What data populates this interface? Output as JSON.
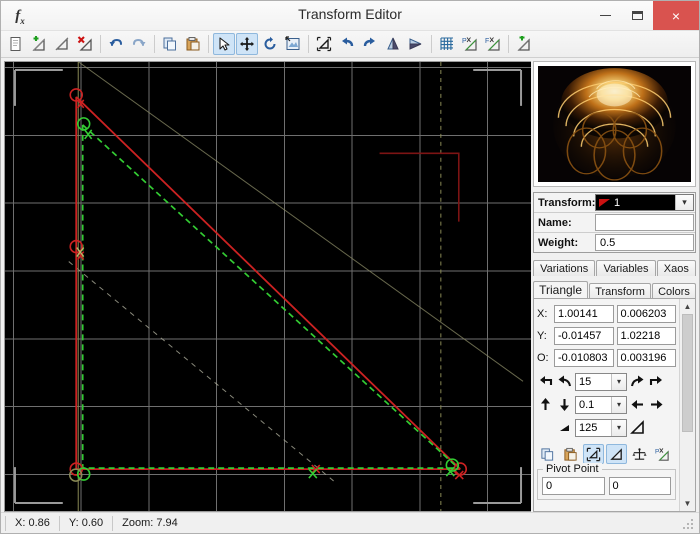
{
  "window": {
    "title": "Transform Editor",
    "app_icon": "fx-icon",
    "minimize_label": "Minimize",
    "maximize_label": "Maximize",
    "close_label": "×"
  },
  "toolbar": {
    "groups": [
      {
        "items": [
          {
            "name": "new-transform-icon",
            "label": "New Transform"
          },
          {
            "name": "add-transform-icon",
            "label": "Add Transform"
          },
          {
            "name": "duplicate-transform-icon",
            "label": "Duplicate Transform"
          },
          {
            "name": "delete-transform-icon",
            "label": "Delete Transform"
          }
        ]
      },
      {
        "items": [
          {
            "name": "undo-icon",
            "label": "Undo"
          },
          {
            "name": "redo-icon",
            "label": "Redo"
          }
        ]
      },
      {
        "items": [
          {
            "name": "copy-icon",
            "label": "Copy"
          },
          {
            "name": "paste-icon",
            "label": "Paste"
          }
        ]
      },
      {
        "items": [
          {
            "name": "select-tool-icon",
            "label": "Select",
            "active": true
          },
          {
            "name": "move-tool-icon",
            "label": "Move",
            "active": true
          },
          {
            "name": "rotate-tool-icon",
            "label": "Rotate"
          },
          {
            "name": "scale-tool-icon",
            "label": "Scale"
          }
        ]
      },
      {
        "items": [
          {
            "name": "reset-triangle-icon",
            "label": "Reset Triangle"
          },
          {
            "name": "rotate-left-icon",
            "label": "Rotate Left"
          },
          {
            "name": "rotate-right-icon",
            "label": "Rotate Right"
          },
          {
            "name": "flip-horizontal-icon",
            "label": "Flip Horizontal"
          },
          {
            "name": "flip-vertical-icon",
            "label": "Flip Vertical"
          }
        ]
      },
      {
        "items": [
          {
            "name": "toggle-grid-icon",
            "label": "Toggle Grid"
          },
          {
            "name": "post-transform-icon",
            "label": "Post Transform"
          },
          {
            "name": "final-transform-icon",
            "label": "Final Transform"
          }
        ]
      },
      {
        "items": [
          {
            "name": "add-final-transform-icon",
            "label": "Add Final Transform"
          }
        ]
      }
    ]
  },
  "preview": {
    "name": "flame-preview",
    "alt": "fractal flame preview"
  },
  "transform_form": {
    "transform_label": "Transform:",
    "transform_value": "1",
    "transform_swatch_color": "#cc1111",
    "name_label": "Name:",
    "name_value": "",
    "name_placeholder": "",
    "weight_label": "Weight:",
    "weight_value": "0.5"
  },
  "tabs_top": [
    {
      "label": "Variations",
      "active": false
    },
    {
      "label": "Variables",
      "active": false
    },
    {
      "label": "Xaos",
      "active": false
    }
  ],
  "tabs_bottom": [
    {
      "label": "Triangle",
      "active": true
    },
    {
      "label": "Transform",
      "active": false
    },
    {
      "label": "Colors",
      "active": false
    }
  ],
  "triangle_panel": {
    "coords": [
      {
        "label": "X:",
        "a": "1.00141",
        "b": "0.006203"
      },
      {
        "label": "Y:",
        "a": "-0.01457",
        "b": "1.02218"
      },
      {
        "label": "O:",
        "a": "-0.010803",
        "b": "0.003196"
      }
    ],
    "rotate_row": {
      "icons": [
        "rotate-left-90-icon",
        "rotate-left-icon",
        "rotate-right-icon",
        "rotate-right-90-icon"
      ],
      "value": "15"
    },
    "move_row": {
      "icons": [
        "move-up-icon",
        "move-down-icon",
        "move-left-icon",
        "move-right-icon"
      ],
      "value": "0.1"
    },
    "scale_row": {
      "icons": [
        "scale-down-icon",
        "scale-up-icon"
      ],
      "value": "125"
    },
    "action_buttons": [
      {
        "name": "copy-triangle-icon",
        "label": "Copy Triangle",
        "active": false
      },
      {
        "name": "paste-triangle-icon",
        "label": "Paste Triangle",
        "active": false
      },
      {
        "name": "reset-triangle-icon",
        "label": "Reset Triangle",
        "active": true
      },
      {
        "name": "show-triangle-icon",
        "label": "Show Triangle",
        "active": true
      },
      {
        "name": "balance-icon",
        "label": "Balance",
        "active": false
      },
      {
        "name": "post-transform-icon",
        "label": "Post Transform",
        "active": false
      }
    ],
    "pivot": {
      "title": "Pivot Point",
      "x": "0",
      "y": "0"
    }
  },
  "statusbar": {
    "x_label": "X: 0.86",
    "y_label": "Y: 0.60",
    "zoom_label": "Zoom: 7.94"
  },
  "canvas": {
    "name": "transform-canvas",
    "background": "#000000",
    "grid_color": "#777777",
    "triangle_red": "#cc2222",
    "triangle_green": "#33cc33",
    "triangle_gray": "#8a8a66"
  }
}
